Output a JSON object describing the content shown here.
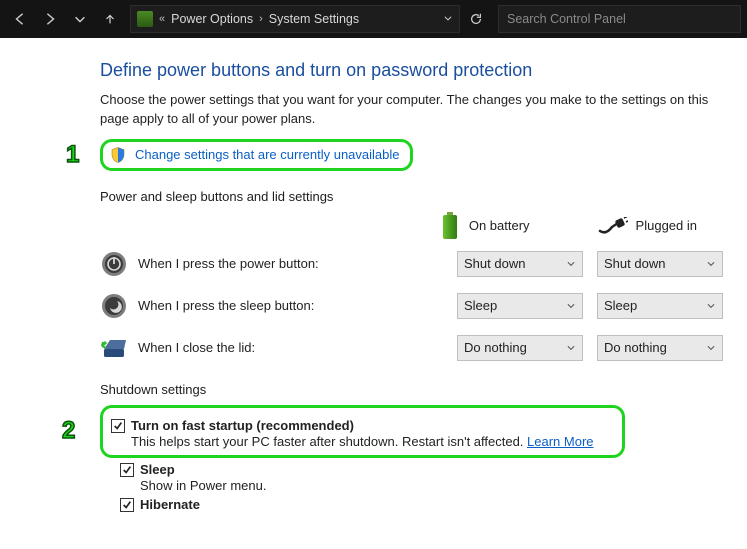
{
  "nav": {
    "breadcrumb": {
      "prefix": "«",
      "item1": "Power Options",
      "item2": "System Settings"
    },
    "search_placeholder": "Search Control Panel"
  },
  "page": {
    "title": "Define power buttons and turn on password protection",
    "description": "Choose the power settings that you want for your computer. The changes you make to the settings on this page apply to all of your power plans.",
    "change_link": "Change settings that are currently unavailable"
  },
  "annotations": {
    "one": "1",
    "two": "2"
  },
  "section1": {
    "heading": "Power and sleep buttons and lid settings",
    "col_battery": "On battery",
    "col_plugged": "Plugged in",
    "rows": [
      {
        "label": "When I press the power button:",
        "battery": "Shut down",
        "plugged": "Shut down"
      },
      {
        "label": "When I press the sleep button:",
        "battery": "Sleep",
        "plugged": "Sleep"
      },
      {
        "label": "When I close the lid:",
        "battery": "Do nothing",
        "plugged": "Do nothing"
      }
    ]
  },
  "section2": {
    "heading": "Shutdown settings",
    "fast_startup": {
      "title": "Turn on fast startup (recommended)",
      "desc": "This helps start your PC faster after shutdown. Restart isn't affected. ",
      "learn": "Learn More"
    },
    "sleep": {
      "title": "Sleep",
      "desc": "Show in Power menu."
    },
    "hibernate": {
      "title": "Hibernate"
    }
  }
}
